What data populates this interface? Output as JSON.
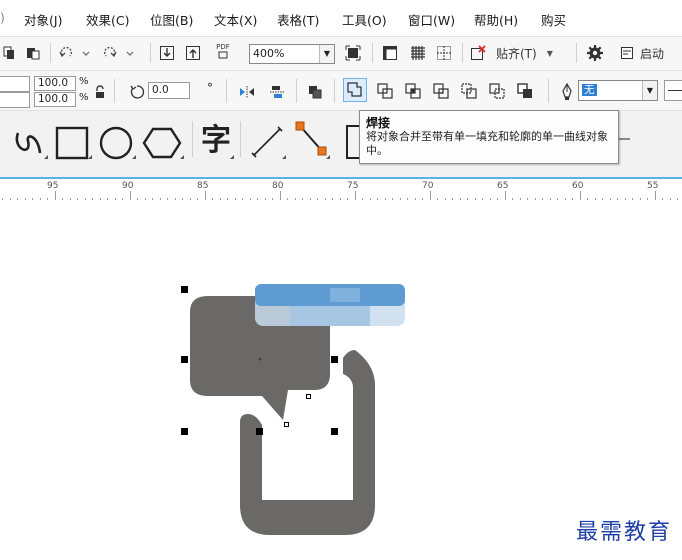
{
  "menu": {
    "items": [
      "对象(J)",
      "效果(C)",
      "位图(B)",
      "文本(X)",
      "表格(T)",
      "工具(O)",
      "窗口(W)",
      "帮助(H)",
      "购买"
    ]
  },
  "toolbar1": {
    "zoom": "400%",
    "snap_label": "贴齐(T)",
    "launch_label": "启动",
    "pdf_label": "PDF"
  },
  "toolbar2": {
    "scale_x": "100.0",
    "scale_y": "100.0",
    "percent_symbol": "%",
    "rotation": "0.0",
    "degree_symbol": "°",
    "outline_value": "无"
  },
  "toolbar3": {
    "text_tool_glyph": "字"
  },
  "tooltip": {
    "title": "焊接",
    "body": "将对象合并至带有单一填充和轮廓的单一曲线对象中。"
  },
  "ruler": {
    "labels": [
      "95",
      "90",
      "85",
      "80",
      "75",
      "70",
      "65",
      "60",
      "55"
    ]
  },
  "canvas": {
    "shape_color": "#6b6968",
    "selection_handle_color": "#000000"
  },
  "watermark": "最需教育",
  "colors": {
    "accent_blue": "#2f7fd2",
    "orange_node": "#e8741c",
    "ruler_line": "#5ab1e3"
  }
}
